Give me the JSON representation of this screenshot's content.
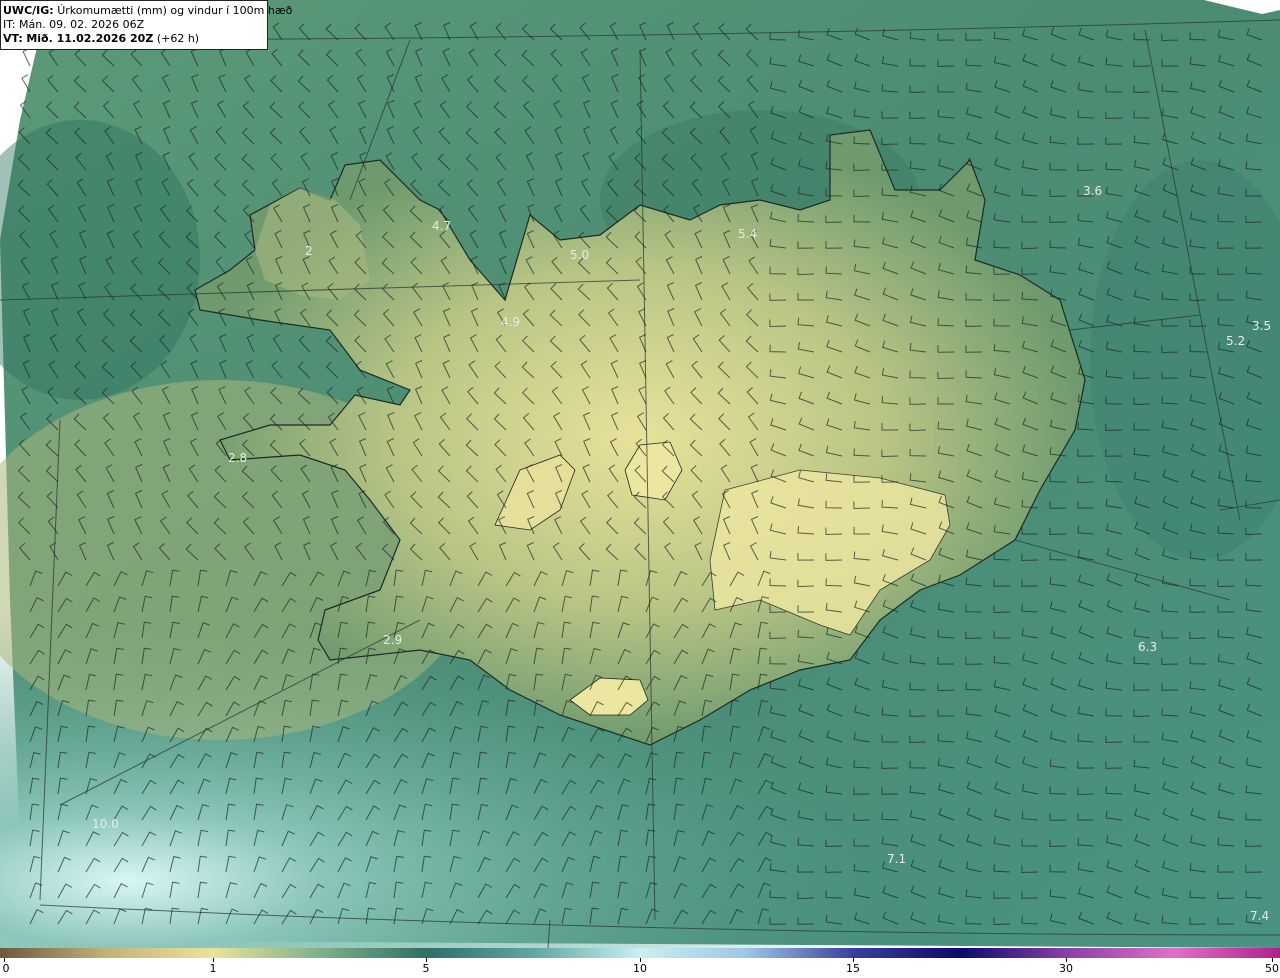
{
  "header": {
    "line1_prefix": "UWC/IG:",
    "line1_text": "Úrkomumætti (mm) og vindur í 100m hæð",
    "line2": "IT: Mán. 09. 02. 2026 06Z",
    "line3_prefix": "VT:",
    "line3_bold": "Mið. 11.02.2026 20Z",
    "line3_suffix": "(+62 h)"
  },
  "values": [
    {
      "label": "4.7"
    },
    {
      "label": "5.0"
    },
    {
      "label": "5.4"
    },
    {
      "label": "3.6"
    },
    {
      "label": "4.9"
    },
    {
      "label": "2"
    },
    {
      "label": "3.5"
    },
    {
      "label": "5.2"
    },
    {
      "label": "2.8"
    },
    {
      "label": "2.9"
    },
    {
      "label": "6.3"
    },
    {
      "label": "10.0"
    },
    {
      "label": "7.1"
    },
    {
      "label": "7.4"
    }
  ],
  "colorbar": {
    "ticks": [
      "0",
      "1",
      "5",
      "10",
      "15",
      "30",
      "50"
    ],
    "colors": [
      "#6b5a3e",
      "#c4b27a",
      "#e8e39a",
      "#7fb08a",
      "#2e6f66",
      "#5fa8a0",
      "#c8f0f0",
      "#9ec6e8",
      "#3a3f9c",
      "#0a0a6a",
      "#8a3fa8",
      "#e070c8",
      "#b0208a"
    ]
  }
}
